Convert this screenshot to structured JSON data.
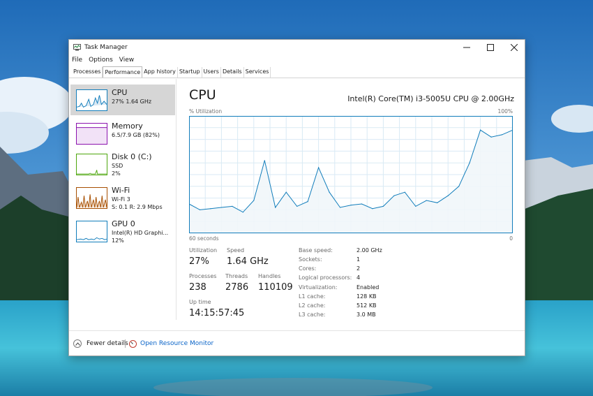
{
  "window": {
    "title": "Task Manager",
    "minimize_icon": "minimize-icon",
    "maximize_icon": "maximize-icon",
    "close_icon": "close-icon"
  },
  "menu": [
    "File",
    "Options",
    "View"
  ],
  "tabs": [
    {
      "label": "Processes",
      "active": false
    },
    {
      "label": "Performance",
      "active": true
    },
    {
      "label": "App history",
      "active": false
    },
    {
      "label": "Startup",
      "active": false
    },
    {
      "label": "Users",
      "active": false
    },
    {
      "label": "Details",
      "active": false
    },
    {
      "label": "Services",
      "active": false
    }
  ],
  "sidebar": [
    {
      "title": "CPU",
      "lines": [
        "27%  1.64 GHz"
      ],
      "color": "#117dbb",
      "selected": true
    },
    {
      "title": "Memory",
      "lines": [
        "6.5/7.9 GB (82%)"
      ],
      "color": "#8b12ae",
      "selected": false
    },
    {
      "title": "Disk 0 (C:)",
      "lines": [
        "SSD",
        "2%"
      ],
      "color": "#4da60c",
      "selected": false
    },
    {
      "title": "Wi-Fi",
      "lines": [
        "Wi-Fi 3",
        "S: 0.1  R: 2.9 Mbps"
      ],
      "color": "#a74f01",
      "selected": false
    },
    {
      "title": "GPU 0",
      "lines": [
        "Intel(R) HD Graphi...",
        "12%"
      ],
      "color": "#117dbb",
      "selected": false
    }
  ],
  "main": {
    "title": "CPU",
    "model": "Intel(R) Core(TM) i3-5005U CPU @ 2.00GHz",
    "y_label": "% Utilization",
    "y_max_label": "100%",
    "x_left_label": "60 seconds",
    "x_right_label": "0",
    "graph_color": "#117dbb",
    "graph_fill": "#f1f6fa",
    "grid_color": "#d9eaf4"
  },
  "stats": {
    "utilization_label": "Utilization",
    "utilization": "27%",
    "speed_label": "Speed",
    "speed": "1.64 GHz",
    "processes_label": "Processes",
    "processes": "238",
    "threads_label": "Threads",
    "threads": "2786",
    "handles_label": "Handles",
    "handles": "110109",
    "uptime_label": "Up time",
    "uptime": "14:15:57:45"
  },
  "specs": [
    {
      "label": "Base speed:",
      "value": "2.00 GHz"
    },
    {
      "label": "Sockets:",
      "value": "1"
    },
    {
      "label": "Cores:",
      "value": "2"
    },
    {
      "label": "Logical processors:",
      "value": "4"
    },
    {
      "label": "Virtualization:",
      "value": "Enabled"
    },
    {
      "label": "L1 cache:",
      "value": "128 KB"
    },
    {
      "label": "L2 cache:",
      "value": "512 KB"
    },
    {
      "label": "L3 cache:",
      "value": "3.0 MB"
    }
  ],
  "footer": {
    "fewer_details": "Fewer details",
    "resource_monitor": "Open Resource Monitor"
  },
  "chart_data": {
    "type": "line",
    "title": "CPU",
    "ylabel": "% Utilization",
    "xlabel": "60 seconds",
    "ylim": [
      0,
      100
    ],
    "x": [
      60,
      58,
      56,
      54,
      52,
      50,
      48,
      46,
      44,
      42,
      40,
      38,
      36,
      34,
      32,
      30,
      28,
      26,
      24,
      22,
      20,
      18,
      16,
      14,
      12,
      10,
      8,
      6,
      4,
      2,
      0
    ],
    "series": [
      {
        "values": [
          25,
          20,
          21,
          22,
          23,
          18,
          28,
          62,
          22,
          35,
          23,
          27,
          56,
          35,
          22,
          24,
          25,
          21,
          23,
          32,
          35,
          23,
          28,
          26,
          32,
          40,
          60,
          88,
          82,
          84,
          88
        ]
      }
    ]
  }
}
